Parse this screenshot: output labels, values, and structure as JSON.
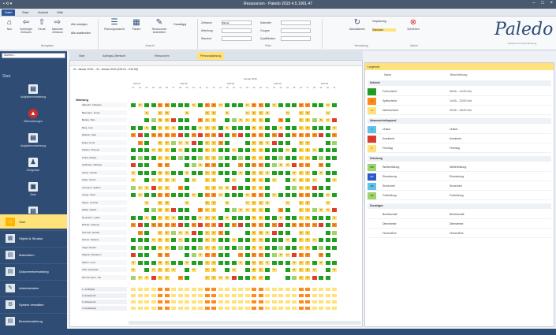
{
  "colors": {
    "green": "#1f9e1f",
    "light_green": "#9fd36b",
    "yellow": "#ffe37a",
    "orange": "#ff8a1a",
    "red": "#e03a2a",
    "blue": "#2f57c9",
    "cyan": "#5fc3e8",
    "white": "#ffffff",
    "weekend": "#ffd24a"
  },
  "window": {
    "title": "Ressourcen - Paledo 2019 4.5.1001.47",
    "quick_access": "▪ ⟲ ▾",
    "controls": {
      "min": "–",
      "max": "□",
      "close": "×"
    }
  },
  "menubar": {
    "items": [
      {
        "label": "Datei",
        "active": true
      },
      {
        "label": "Start",
        "active": false
      },
      {
        "label": "Ansicht",
        "active": false
      },
      {
        "label": "Hilfe",
        "active": false
      }
    ]
  },
  "ribbon": {
    "buttons": [
      {
        "label": "Neu",
        "icon": "home-icon"
      },
      {
        "label": "Vorheriger Zeitraum",
        "icon": "arrow-left-icon"
      },
      {
        "label": "Heute",
        "icon": "arrow-up-icon"
      },
      {
        "label": "Nächster Zeitraum",
        "icon": "arrow-right-icon"
      },
      {
        "label": "Planungsansicht",
        "icon": "list-icon"
      },
      {
        "label": "Planen",
        "icon": "calendar-icon"
      },
      {
        "label": "Ressourcen bearbeiten",
        "icon": "edit-icon"
      },
      {
        "label": "Aktualisieren",
        "icon": "refresh-icon"
      },
      {
        "label": "Schließen",
        "icon": "close-icon"
      }
    ],
    "small": [
      {
        "label": "Alle anzeigen"
      },
      {
        "label": "Alle ausblenden"
      },
      {
        "label": "Ganztägig"
      },
      {
        "label": "Vorplanung"
      },
      {
        "label": "Standard",
        "highlighted": true
      }
    ],
    "fields": [
      {
        "label": "Zeitraum",
        "value": "Monat"
      },
      {
        "label": "Abteilung",
        "value": ""
      },
      {
        "label": "Standort",
        "value": ""
      },
      {
        "label": "Kalender",
        "value": ""
      },
      {
        "label": "Gruppe",
        "value": ""
      },
      {
        "label": "Qualifikation",
        "value": ""
      }
    ],
    "groups": [
      "Navigation",
      "Ansicht",
      "Filter",
      "Verwaltung",
      "Aktion"
    ]
  },
  "logo": {
    "text": "Paledo",
    "sub": "Software für Instandhaltung"
  },
  "sidebar": {
    "search_placeholder": "Suchen...",
    "heading": "Start",
    "tiles": [
      "Aufgabenverwaltung",
      "Störmeldungen",
      "Aufgabenumsetzung",
      "Ereignisse",
      "Ziele",
      "Geschäftsvorfälle"
    ],
    "rows": [
      {
        "label": "Start",
        "icon": "home-icon",
        "selected": true
      },
      {
        "label": "Objekt & Struktur",
        "icon": "tree-icon"
      },
      {
        "label": "Materialien",
        "icon": "box-icon"
      },
      {
        "label": "Dokumentverwaltung",
        "icon": "document-icon"
      },
      {
        "label": "Administration",
        "icon": "wrench-icon"
      },
      {
        "label": "System verwalten",
        "icon": "gear-icon"
      },
      {
        "label": "Berichterstellung",
        "icon": "report-icon"
      }
    ]
  },
  "tabs": [
    {
      "label": "Start"
    },
    {
      "label": "Auftrags-Übersicht"
    },
    {
      "label": "Ressourcen"
    },
    {
      "label": "Personalplanung",
      "active": true
    }
  ],
  "grid": {
    "range": "01. Januar 2019 – 31. Januar 2019 (KW 01 - KW 05)",
    "month": "Januar 2019",
    "weeks": [
      "KW 01",
      "KW 02",
      "KW 03",
      "KW 04",
      "KW 05"
    ],
    "days": [
      "01",
      "02",
      "03",
      "04",
      "05",
      "06",
      "07",
      "08",
      "09",
      "10",
      "11",
      "12",
      "13",
      "14",
      "15",
      "16",
      "17",
      "18",
      "19",
      "20",
      "21",
      "22",
      "23",
      "24",
      "25",
      "26",
      "27",
      "28",
      "29",
      "30",
      "31"
    ],
    "group_label": "Wartung",
    "employees": [
      "Albrecht, Christian",
      "Baumann, Jonas",
      "Becker, Max",
      "Berg, Lisa",
      "Dietrich, Paul",
      "Engel, Anna",
      "Fischer, Thomas",
      "Frank, Philipp",
      "Hoffmann, Michael",
      "Kaiser, Florian",
      "Keller, Simon",
      "Lehmann, Sabine",
      "Lange, Peter",
      "Meyer, Jennifer",
      "Müller, Stefan",
      "Neumann, Lukas",
      "Richter, Andreas",
      "Schmidt, Sandra",
      "Schulz, Stefanie",
      "Vogel, Daniel",
      "Wagner, Benjamin",
      "Weber, Lena",
      "Wolf, Sebastian",
      "Zimmermann, Jan"
    ],
    "summary": [
      "1. Verfügbar",
      "2. Anwesend",
      "3. Abwesend",
      "4. Auslastung"
    ]
  },
  "legend": {
    "title": "Legende",
    "col_name": "Name",
    "col_desc": "Beschreibung",
    "sections": [
      {
        "name": "Schicht",
        "rows": [
          {
            "code": "F",
            "color": "#1f9e1f",
            "name": "Frühschicht",
            "desc": "06:00 – 14:00 Uhr"
          },
          {
            "code": "S",
            "color": "#ff8a1a",
            "name": "Spätschicht",
            "desc": "14:00 – 22:00 Uhr"
          },
          {
            "code": "N",
            "color": "#ffe37a",
            "name": "Nachtschicht",
            "desc": "22:00 – 06:00 Uhr"
          }
        ]
      },
      {
        "name": "Abwesenheitsgrund",
        "rows": [
          {
            "code": "U",
            "color": "#5fc3e8",
            "name": "Urlaub",
            "desc": "Urlaub"
          },
          {
            "code": "K",
            "color": "#e03a2a",
            "name": "Krankheit",
            "desc": "Krankheit"
          },
          {
            "code": "F",
            "color": "#ffe37a",
            "name": "Feiertag",
            "desc": "Feiertag"
          }
        ]
      },
      {
        "name": "Schulung",
        "rows": [
          {
            "code": "WB",
            "color": "#9fd36b",
            "name": "Weiterbildung",
            "desc": "Weiterbildung"
          },
          {
            "code": "ES",
            "color": "#2f57c9",
            "name": "Einweisung",
            "desc": "Einweisung"
          },
          {
            "code": "SB",
            "color": "#5fc3e8",
            "name": "Sicherheit",
            "desc": "Sicherheit"
          },
          {
            "code": "FB",
            "color": "#9fd36b",
            "name": "Fortbildung",
            "desc": "Fortbildung"
          }
        ]
      },
      {
        "name": "Sonstiges",
        "rows": [
          {
            "code": "",
            "color": "#ffffff",
            "name": "Bereitschaft",
            "desc": "Bereitschaft"
          },
          {
            "code": "",
            "color": "#ffffff",
            "name": "Dienstreise",
            "desc": "Dienstreise"
          },
          {
            "code": "",
            "color": "#ffffff",
            "name": "Homeoffice",
            "desc": "Homeoffice"
          }
        ]
      }
    ]
  }
}
